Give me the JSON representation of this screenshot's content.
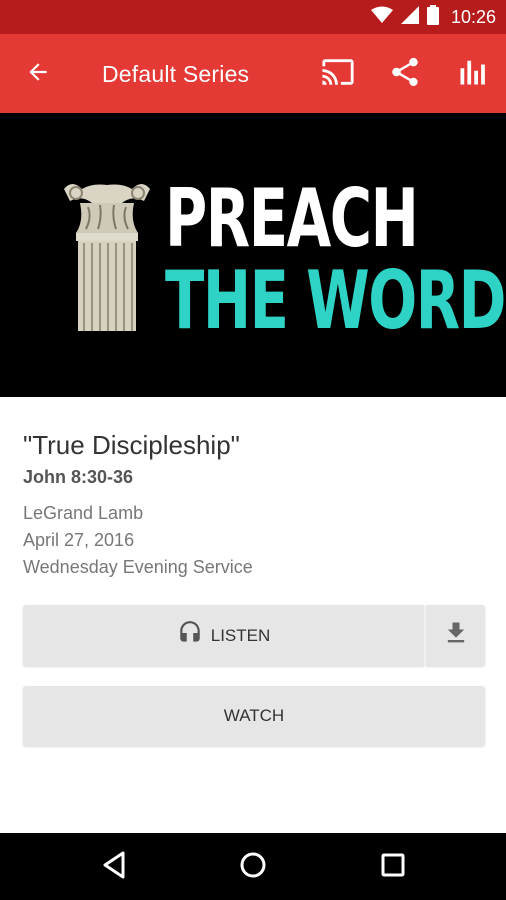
{
  "status_bar": {
    "time": "10:26",
    "icons": [
      "wifi-icon",
      "signal-icon",
      "battery-icon"
    ]
  },
  "app_bar": {
    "title": "Default Series",
    "actions": [
      "cast-icon",
      "share-icon",
      "bar-chart-icon"
    ],
    "color": "#e53935"
  },
  "banner": {
    "line1": "PREACH",
    "line2": "THE WORD",
    "line2_color": "#2ed3c6"
  },
  "sermon": {
    "title": "\"True Discipleship\"",
    "scripture": "John 8:30-36",
    "speaker": "LeGrand Lamb",
    "date": "April 27, 2016",
    "event": "Wednesday Evening Service"
  },
  "buttons": {
    "listen_label": "LISTEN",
    "watch_label": "WATCH"
  },
  "nav_bar": {
    "icons": [
      "back-triangle-icon",
      "home-circle-icon",
      "recents-square-icon"
    ]
  }
}
